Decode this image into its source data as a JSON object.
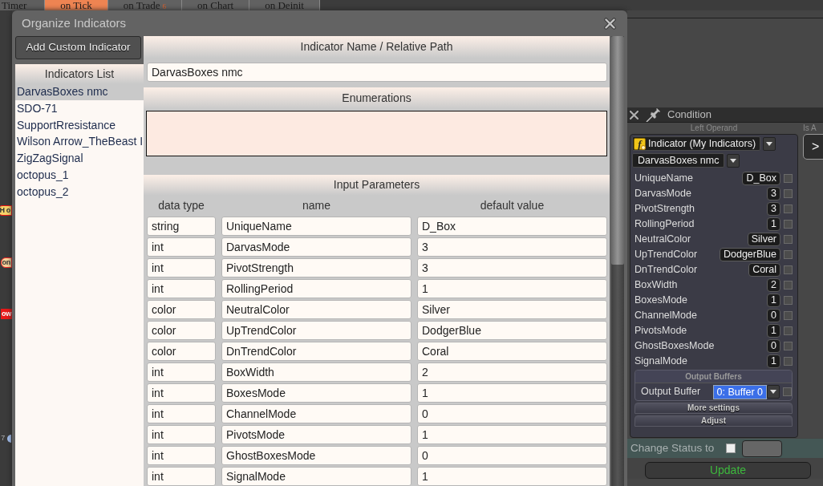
{
  "background_tabs": [
    {
      "label": "Timer",
      "selected": false
    },
    {
      "label": "on Tick",
      "selected": true
    },
    {
      "label": "on Trade",
      "selected": false,
      "count": "6"
    },
    {
      "label": "on Chart",
      "selected": false
    },
    {
      "label": "on Deinit",
      "selected": false
    }
  ],
  "edge_fragments": [
    {
      "text": "H o",
      "kind": "yellow"
    },
    {
      "text": "on",
      "kind": "amber"
    },
    {
      "text": "ow",
      "kind": "red"
    },
    {
      "text": "7",
      "kind": "grey"
    }
  ],
  "dialog": {
    "title": "Organize Indicators",
    "add_button": "Add Custom Indicator",
    "indicators_list": {
      "title": "Indicators List",
      "items": [
        {
          "label": "DarvasBoxes nmc",
          "selected": true
        },
        {
          "label": "SDO-71",
          "selected": false
        },
        {
          "label": "SupportRresistance",
          "selected": false
        },
        {
          "label": "Wilson Arrow_TheBeast I",
          "selected": false
        },
        {
          "label": "ZigZagSignal",
          "selected": false
        },
        {
          "label": "octopus_1",
          "selected": false
        },
        {
          "label": "octopus_2",
          "selected": false
        }
      ]
    },
    "name_section": {
      "title": "Indicator Name / Relative Path",
      "value": "DarvasBoxes nmc"
    },
    "enumerations": {
      "title": "Enumerations"
    },
    "input_parameters": {
      "title": "Input Parameters",
      "columns": [
        "data type",
        "name",
        "default value"
      ],
      "rows": [
        [
          "string",
          "UniqueName",
          "D_Box"
        ],
        [
          "int",
          "DarvasMode",
          "3"
        ],
        [
          "int",
          "PivotStrength",
          "3"
        ],
        [
          "int",
          "RollingPeriod",
          "1"
        ],
        [
          "color",
          "NeutralColor",
          "Silver"
        ],
        [
          "color",
          "UpTrendColor",
          "DodgerBlue"
        ],
        [
          "color",
          "DnTrendColor",
          "Coral"
        ],
        [
          "int",
          "BoxWidth",
          "2"
        ],
        [
          "int",
          "BoxesMode",
          "1"
        ],
        [
          "int",
          "ChannelMode",
          "0"
        ],
        [
          "int",
          "PivotsMode",
          "1"
        ],
        [
          "int",
          "GhostBoxesMode",
          "0"
        ],
        [
          "int",
          "SignalMode",
          "1"
        ]
      ]
    }
  },
  "condition_panel": {
    "title": "Condition",
    "left_operand": {
      "label": "Left Operand",
      "source_icon": "f",
      "source": "Indicator (My Indicators)",
      "indicator": "DarvasBoxes nmc",
      "params": [
        {
          "name": "UniqueName",
          "value": "D_Box",
          "checked": false
        },
        {
          "name": "DarvasMode",
          "value": "3",
          "checked": false
        },
        {
          "name": "PivotStrength",
          "value": "3",
          "checked": false
        },
        {
          "name": "RollingPeriod",
          "value": "1",
          "checked": false
        },
        {
          "name": "NeutralColor",
          "value": "Silver",
          "checked": false
        },
        {
          "name": "UpTrendColor",
          "value": "DodgerBlue",
          "checked": false
        },
        {
          "name": "DnTrendColor",
          "value": "Coral",
          "checked": false
        },
        {
          "name": "BoxWidth",
          "value": "2",
          "checked": false
        },
        {
          "name": "BoxesMode",
          "value": "1",
          "checked": false
        },
        {
          "name": "ChannelMode",
          "value": "0",
          "checked": false
        },
        {
          "name": "PivotsMode",
          "value": "1",
          "checked": false
        },
        {
          "name": "GhostBoxesMode",
          "value": "0",
          "checked": false
        },
        {
          "name": "SignalMode",
          "value": "1",
          "checked": false
        }
      ],
      "output_buffers": {
        "title": "Output Buffers",
        "label": "Output Buffer",
        "value": "0: Buffer 0",
        "checked": false
      },
      "more_settings": "More settings",
      "adjust": "Adjust"
    },
    "right_label": "Is A",
    "operator": ">",
    "change_status": {
      "label": "Change Status to",
      "checked": false
    },
    "update_button": "Update"
  }
}
